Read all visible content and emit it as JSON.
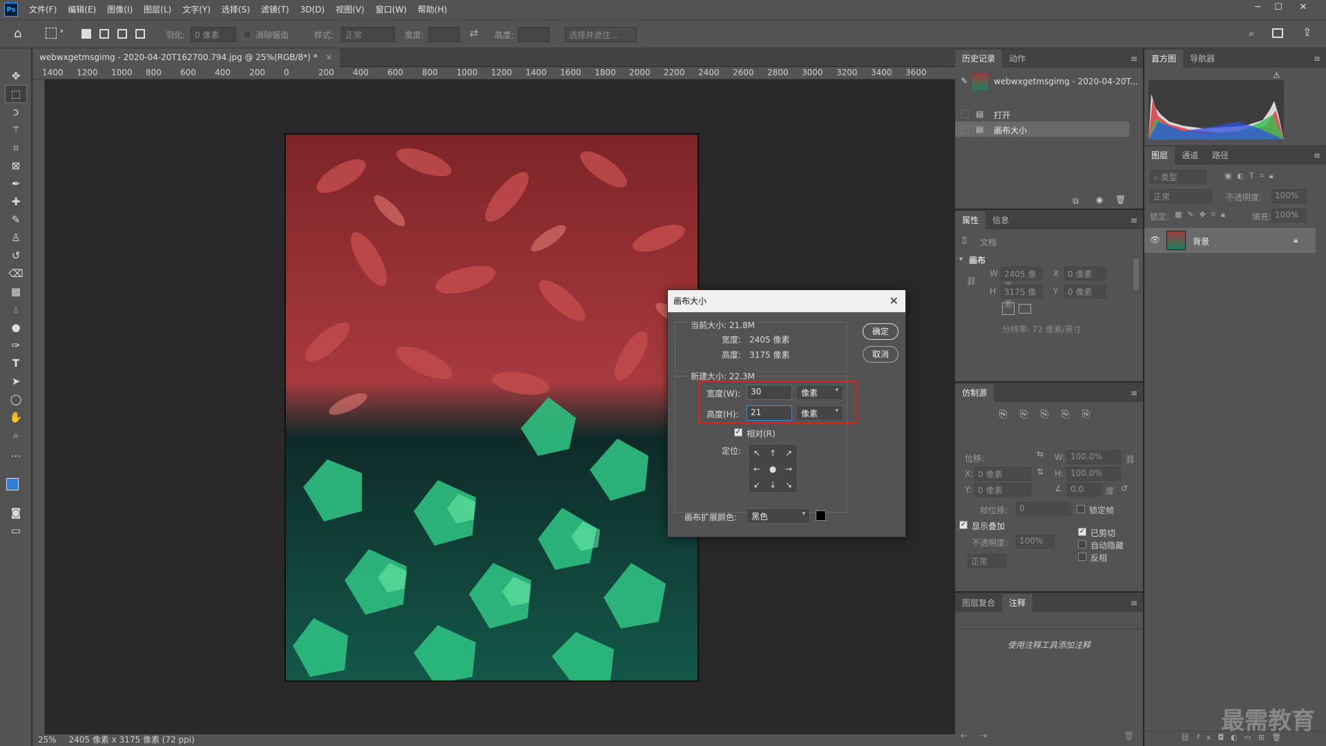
{
  "menubar": {
    "items": [
      "文件(F)",
      "编辑(E)",
      "图像(I)",
      "图层(L)",
      "文字(Y)",
      "选择(S)",
      "滤镜(T)",
      "3D(D)",
      "视图(V)",
      "窗口(W)",
      "帮助(H)"
    ],
    "logo": "Ps"
  },
  "options": {
    "feather_label": "羽化:",
    "feather_value": "0 像素",
    "antialias_label": "消除锯齿",
    "style_label": "样式:",
    "style_value": "正常",
    "width_label": "宽度:",
    "height_label": "高度:",
    "select_mask_label": "选择并遮住..."
  },
  "document": {
    "tab_title": "webwxgetmsgimg - 2020-04-20T162700.794.jpg @ 25%(RGB/8*) *",
    "close": "×",
    "zoom": "25%",
    "status_info": "2405 像素 x 3175 像素 (72 ppi)"
  },
  "ruler": {
    "labels": [
      "1400",
      "1200",
      "1000",
      "800",
      "600",
      "400",
      "200",
      "0",
      "200",
      "400",
      "600",
      "800",
      "1000",
      "1200",
      "1400",
      "1600",
      "1800",
      "2000",
      "2200",
      "2400",
      "2600",
      "2800",
      "3000",
      "3200",
      "3400",
      "3600"
    ]
  },
  "dialog": {
    "title": "画布大小",
    "current_size_label": "当前大小: 21.8M",
    "current_width_label": "宽度:",
    "current_width_value": "2405 像素",
    "current_height_label": "高度:",
    "current_height_value": "3175 像素",
    "new_size_label": "新建大小: 22.3M",
    "width_label": "宽度(W):",
    "width_value": "30",
    "width_unit": "像素",
    "height_label": "高度(H):",
    "height_value": "21",
    "height_unit": "像素",
    "relative_label": "相对(R)",
    "anchor_label": "定位:",
    "ext_color_label": "画布扩展颜色:",
    "ext_color_value": "黑色",
    "ok_label": "确定",
    "cancel_label": "取消",
    "highlight_color": "#e02020"
  },
  "history_panel": {
    "tabs": [
      "历史记录",
      "动作"
    ],
    "snapshot": "webwxgetmsgimg - 2020-04-20T...",
    "items": [
      "打开",
      "画布大小"
    ]
  },
  "properties_panel": {
    "tabs": [
      "属性",
      "信息"
    ],
    "doc_label": "文档",
    "canvas_label": "画布",
    "w_label": "W",
    "w_value": "2405 像素",
    "h_label": "H",
    "h_value": "3175 像素",
    "x_label": "X",
    "x_value": "0 像素",
    "y_label": "Y",
    "y_value": "0 像素",
    "resolution": "分辨率: 72 像素/英寸"
  },
  "clone_panel": {
    "tab": "仿制源",
    "offset_label": "位移:",
    "x_label": "X:",
    "x_value": "0 像素",
    "y_label": "Y:",
    "y_value": "0 像素",
    "w_label": "W:",
    "w_value": "100.0%",
    "h_label": "H:",
    "h_value": "100.0%",
    "angle_value": "0.0",
    "angle_unit": "度",
    "frame_offset_label": "帧位移:",
    "frame_offset_value": "0",
    "lock_frame_label": "锁定帧",
    "show_overlay_label": "显示叠加",
    "opacity_label": "不透明度:",
    "opacity_value": "100%",
    "blend_value": "正常",
    "clipped_label": "已剪切",
    "auto_hide_label": "自动隐藏",
    "invert_label": "反相"
  },
  "notes_panel": {
    "tabs": [
      "图层复合",
      "注释"
    ],
    "hint": "使用注释工具添加注释"
  },
  "histogram_panel": {
    "tabs": [
      "直方图",
      "导航器"
    ]
  },
  "layers_panel": {
    "tabs": [
      "图层",
      "通道",
      "路径"
    ],
    "filter_placeholder": "类型",
    "blend_mode": "正常",
    "opacity_label": "不透明度:",
    "opacity_value": "100%",
    "lock_label": "锁定:",
    "fill_label": "填充:",
    "fill_value": "100%",
    "layer_name": "背景"
  },
  "watermark": "最需教育"
}
